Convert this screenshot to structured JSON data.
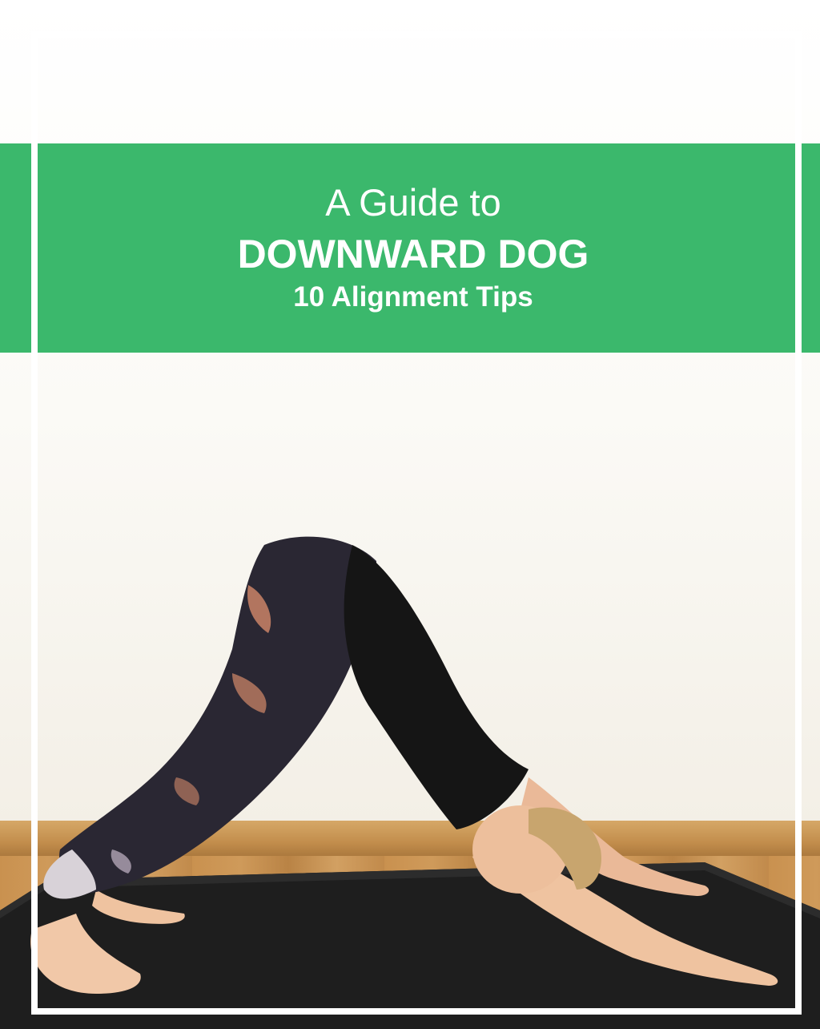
{
  "cover": {
    "title_line1": "A Guide to",
    "title_line2": "DOWNWARD DOG",
    "subtitle": "10 Alignment Tips"
  },
  "colors": {
    "accent_band": "#3bb86c",
    "frame": "#ffffff",
    "text": "#ffffff"
  }
}
